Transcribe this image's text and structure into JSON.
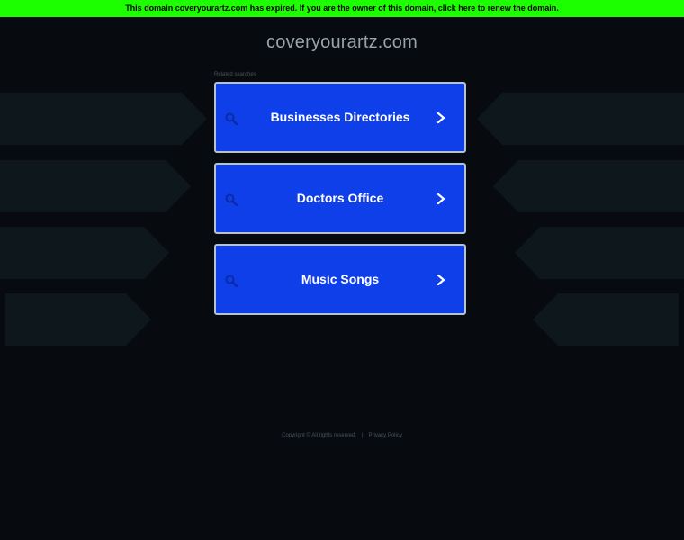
{
  "banner": {
    "text": "This domain coveryourartz.com has expired. If you are the owner of this domain, click here to renew the domain."
  },
  "header": {
    "domain": "coveryourartz.com"
  },
  "related": {
    "label": "Related searches",
    "items": [
      {
        "label": "Businesses Directories"
      },
      {
        "label": "Doctors Office"
      },
      {
        "label": "Music Songs"
      }
    ]
  },
  "footer": {
    "copyright": "Copyright © All rights reserved.",
    "separator": "|",
    "privacy": "Privacy Policy"
  },
  "colors": {
    "banner_bg": "#1cff00",
    "page_bg": "#070b0f",
    "button_bg": "#0f3fe8",
    "button_border": "#b8c2cc"
  },
  "icons": {
    "search": "search-icon",
    "chevron": "chevron-right-icon"
  }
}
